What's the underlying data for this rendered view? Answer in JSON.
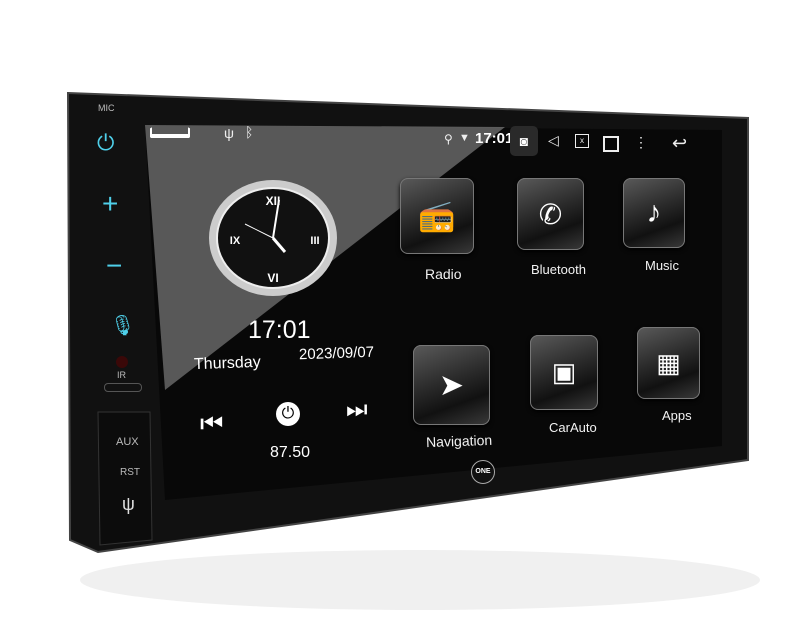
{
  "device": {
    "side_panel": {
      "mic_label": "MIC",
      "ir_label": "IR",
      "aux_label": "AUX",
      "rst_label": "RST",
      "accent_color": "#4fd0ea"
    },
    "logo_text": "ONE"
  },
  "status_bar": {
    "time": "17:01",
    "icons": [
      "home-icon",
      "usb-icon",
      "bluetooth-icon",
      "location-icon",
      "wifi-icon",
      "screenshot-icon",
      "volume-icon",
      "close-window-icon",
      "recent-apps-icon",
      "more-icon",
      "back-icon"
    ]
  },
  "clock_widget": {
    "numerals": [
      "XII",
      "III",
      "VI",
      "IX"
    ],
    "time": "17:01",
    "day": "Thursday",
    "date": "2023/09/07"
  },
  "radio_widget": {
    "frequency": "87.50"
  },
  "apps": [
    {
      "label": "Radio",
      "icon": "radio-icon"
    },
    {
      "label": "Bluetooth",
      "icon": "bluetooth-phone-icon"
    },
    {
      "label": "Music",
      "icon": "music-note-icon"
    },
    {
      "label": "Navigation",
      "icon": "navigation-arrow-icon"
    },
    {
      "label": "CarAuto",
      "icon": "carauto-icon"
    },
    {
      "label": "Apps",
      "icon": "apps-grid-icon"
    }
  ]
}
